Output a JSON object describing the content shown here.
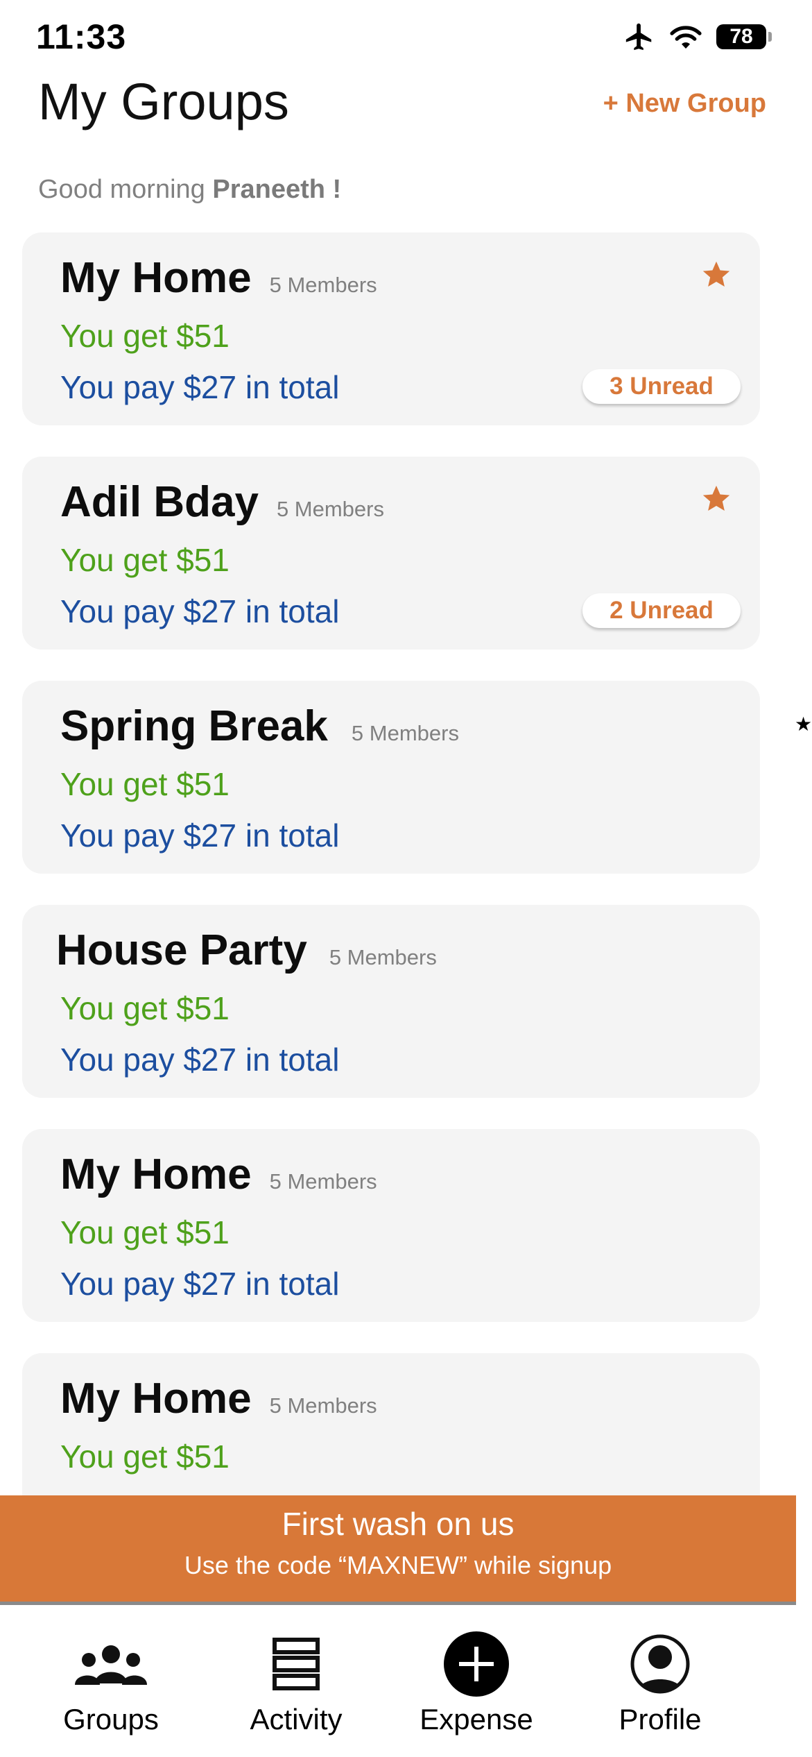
{
  "status_bar": {
    "time": "11:33",
    "battery": "78",
    "icons": [
      "airplane-icon",
      "wifi-icon",
      "battery-icon"
    ]
  },
  "header": {
    "title": "My Groups",
    "new_group_label": "+ New Group",
    "greeting_prefix": "Good morning",
    "greeting_name": "Praneeth !"
  },
  "groups": [
    {
      "name": "My Home",
      "members": "5 Members",
      "get": "You get $51",
      "pay": "You pay $27 in total",
      "starred": true,
      "unread": "3 Unread"
    },
    {
      "name": "Adil Bday",
      "members": "5 Members",
      "get": "You get $51",
      "pay": "You pay $27 in total",
      "starred": true,
      "unread": "2 Unread"
    },
    {
      "name": "Spring Break",
      "members": "5 Members",
      "get": "You get $51",
      "pay": "You pay $27 in total",
      "starred": false,
      "unread": ""
    },
    {
      "name": "House Party",
      "members": "5 Members",
      "get": "You get $51",
      "pay": "You pay $27 in total",
      "starred": false,
      "unread": ""
    },
    {
      "name": "My Home",
      "members": "5 Members",
      "get": "You get $51",
      "pay": "You pay $27 in total",
      "starred": false,
      "unread": ""
    },
    {
      "name": "My Home",
      "members": "5 Members",
      "get": "You get $51",
      "pay": "",
      "starred": false,
      "unread": ""
    }
  ],
  "promo": {
    "title": "First wash on us",
    "subtitle": "Use the code “MAXNEW” while signup"
  },
  "tab_bar": {
    "items": [
      {
        "label": "Groups",
        "icon": "groups-icon"
      },
      {
        "label": "Activity",
        "icon": "activity-icon"
      },
      {
        "label": "Expense",
        "icon": "add-expense-icon"
      },
      {
        "label": "Profile",
        "icon": "profile-icon"
      }
    ]
  },
  "colors": {
    "accent": "#d8783a",
    "get_green": "#4ea11b",
    "pay_blue": "#1c4e9f",
    "card_bg": "#f4f4f4",
    "promo_bg": "#d87838"
  }
}
